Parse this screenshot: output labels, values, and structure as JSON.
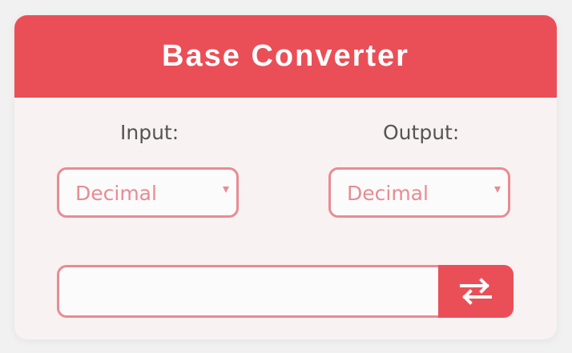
{
  "header": {
    "title": "Base Converter"
  },
  "input_panel": {
    "label": "Input:",
    "selected_base": "Decimal"
  },
  "output_panel": {
    "label": "Output:",
    "selected_base": "Decimal"
  },
  "value_field": {
    "value": "",
    "placeholder": ""
  },
  "swap_button": {
    "icon": "swap-arrows-icon"
  },
  "colors": {
    "accent": "#ea4f58",
    "border": "#e98b92",
    "card_bg": "#f9f2f2",
    "label_text": "#555555"
  }
}
